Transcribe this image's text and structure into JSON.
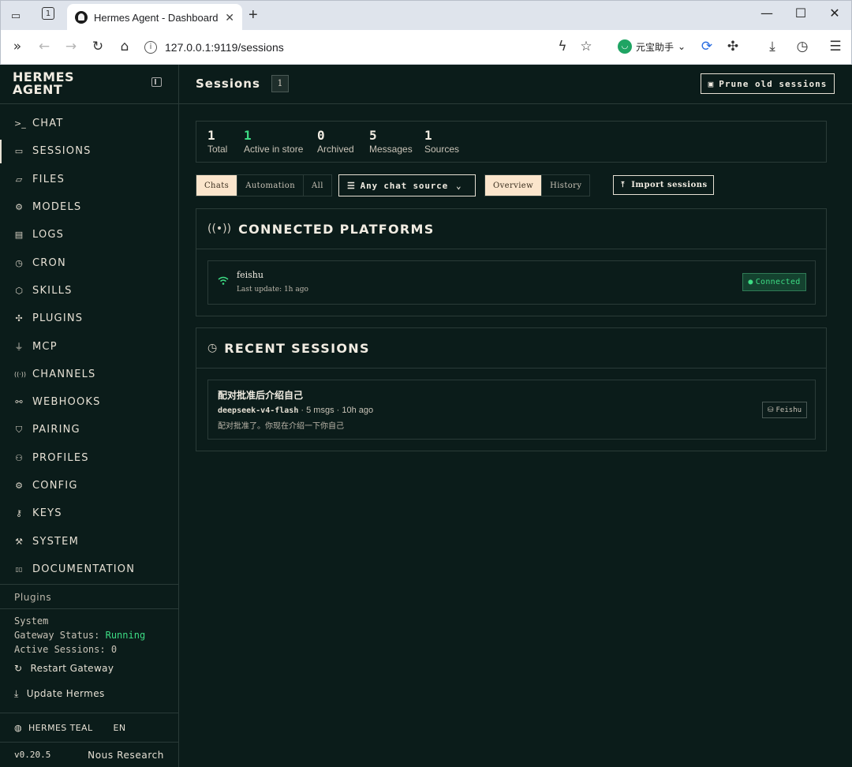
{
  "browser": {
    "tab_title": "Hermes Agent - Dashboard",
    "tab_count": "1",
    "url": "127.0.0.1:9119/sessions",
    "extension_label": "元宝助手"
  },
  "brand": {
    "line1": "HERMES",
    "line2": "AGENT"
  },
  "nav": [
    {
      "icon": ">_",
      "label": "CHAT"
    },
    {
      "icon": "▭",
      "label": "SESSIONS"
    },
    {
      "icon": "▱",
      "label": "FILES"
    },
    {
      "icon": "⚙",
      "label": "MODELS"
    },
    {
      "icon": "▤",
      "label": "LOGS"
    },
    {
      "icon": "◷",
      "label": "CRON"
    },
    {
      "icon": "⬡",
      "label": "SKILLS"
    },
    {
      "icon": "✣",
      "label": "PLUGINS"
    },
    {
      "icon": "⏚",
      "label": "MCP"
    },
    {
      "icon": "((·))",
      "label": "CHANNELS"
    },
    {
      "icon": "⚯",
      "label": "WEBHOOKS"
    },
    {
      "icon": "⛉",
      "label": "PAIRING"
    },
    {
      "icon": "⚇",
      "label": "PROFILES"
    },
    {
      "icon": "⚙",
      "label": "CONFIG"
    },
    {
      "icon": "⚷",
      "label": "KEYS"
    },
    {
      "icon": "⚒",
      "label": "SYSTEM"
    },
    {
      "icon": "▯▯",
      "label": "DOCUMENTATION"
    }
  ],
  "sidebar_sections": {
    "plugins": "Plugins",
    "system_title": "System",
    "gateway_label": "Gateway Status: ",
    "gateway_value": "Running",
    "active_sessions": "Active Sessions: 0",
    "restart": "Restart Gateway",
    "update": "Update Hermes",
    "theme": "HERMES TEAL",
    "lang": "EN",
    "version": "v0.20.5",
    "org": "Nous Research"
  },
  "header": {
    "title": "Sessions",
    "count": "1",
    "prune_label": "Prune old sessions"
  },
  "stats": [
    {
      "value": "1",
      "label": "Total"
    },
    {
      "value": "1",
      "label": "Active in store"
    },
    {
      "value": "0",
      "label": "Archived"
    },
    {
      "value": "5",
      "label": "Messages"
    },
    {
      "value": "1",
      "label": "Sources"
    }
  ],
  "filters": {
    "kind_options": [
      "Chats",
      "Automation",
      "All"
    ],
    "source_select": "Any chat source",
    "view_options": [
      "Overview",
      "History"
    ],
    "import_label": "Import sessions"
  },
  "platforms": {
    "heading": "CONNECTED PLATFORMS",
    "items": [
      {
        "name": "feishu",
        "last_update": "Last update: 1h ago",
        "status": "Connected"
      }
    ]
  },
  "recent": {
    "heading": "RECENT SESSIONS",
    "items": [
      {
        "title": "配对批准后介绍自己",
        "model": "deepseek-v4-flash",
        "meta": " · 5 msgs · 10h ago",
        "preview": "配对批准了。你现在介绍一下你自己",
        "source": "Feishu"
      }
    ]
  },
  "colors": {
    "background": "#0b1c1a",
    "accent_cream": "#fbe5cc",
    "status_green": "#3ddc84",
    "border": "#2a3b38"
  }
}
